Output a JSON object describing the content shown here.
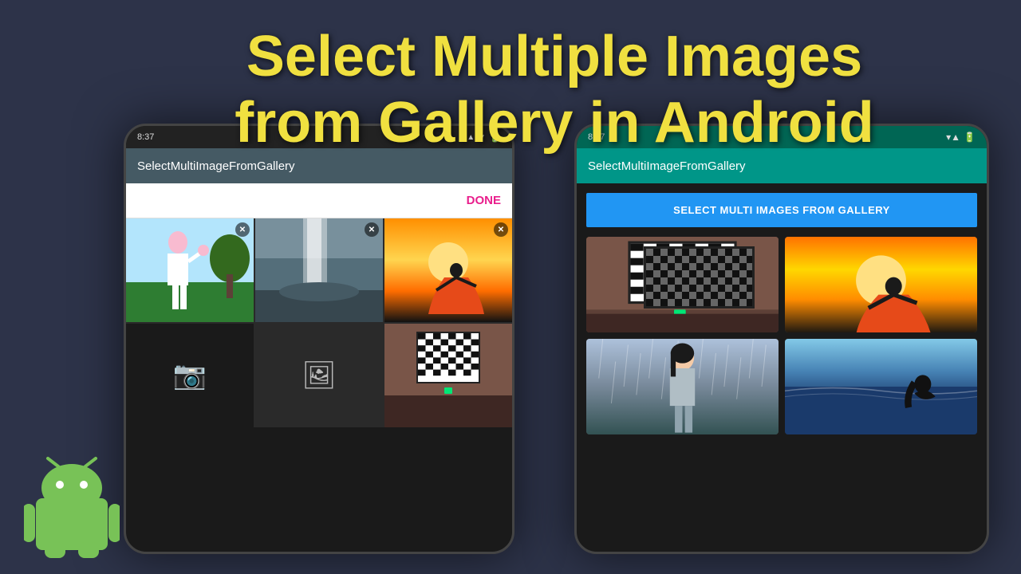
{
  "title": {
    "line1": "Select Multiple Images",
    "line2": "from Gallery in Android"
  },
  "phone_left": {
    "status_bar": {
      "time": "8:37",
      "icons": [
        "▲",
        "▼",
        "●"
      ]
    },
    "app_bar": "SelectMultiImageFromGallery",
    "picker_bar": {
      "done_label": "DONE"
    },
    "grid_cells": [
      {
        "id": "girl-white",
        "has_x": true
      },
      {
        "id": "waterfall",
        "has_x": true
      },
      {
        "id": "sunset-dancer",
        "has_x": true
      },
      {
        "id": "camera",
        "has_x": false,
        "icon": "📷"
      },
      {
        "id": "gallery",
        "has_x": false,
        "icon": "🖼"
      },
      {
        "id": "room",
        "has_x": false
      }
    ]
  },
  "phone_right": {
    "status_bar": {
      "time": "8:37",
      "icons": [
        "▲",
        "▲",
        "●"
      ]
    },
    "app_bar": "SelectMultiImageFromGallery",
    "select_button_label": "SELECT MULTI IMAGES FROM GALLERY",
    "grid_images": [
      {
        "id": "chess-room"
      },
      {
        "id": "sunset2"
      },
      {
        "id": "girl-rain"
      },
      {
        "id": "sea"
      }
    ]
  },
  "android_logo": {
    "alt": "Android mascot logo"
  }
}
